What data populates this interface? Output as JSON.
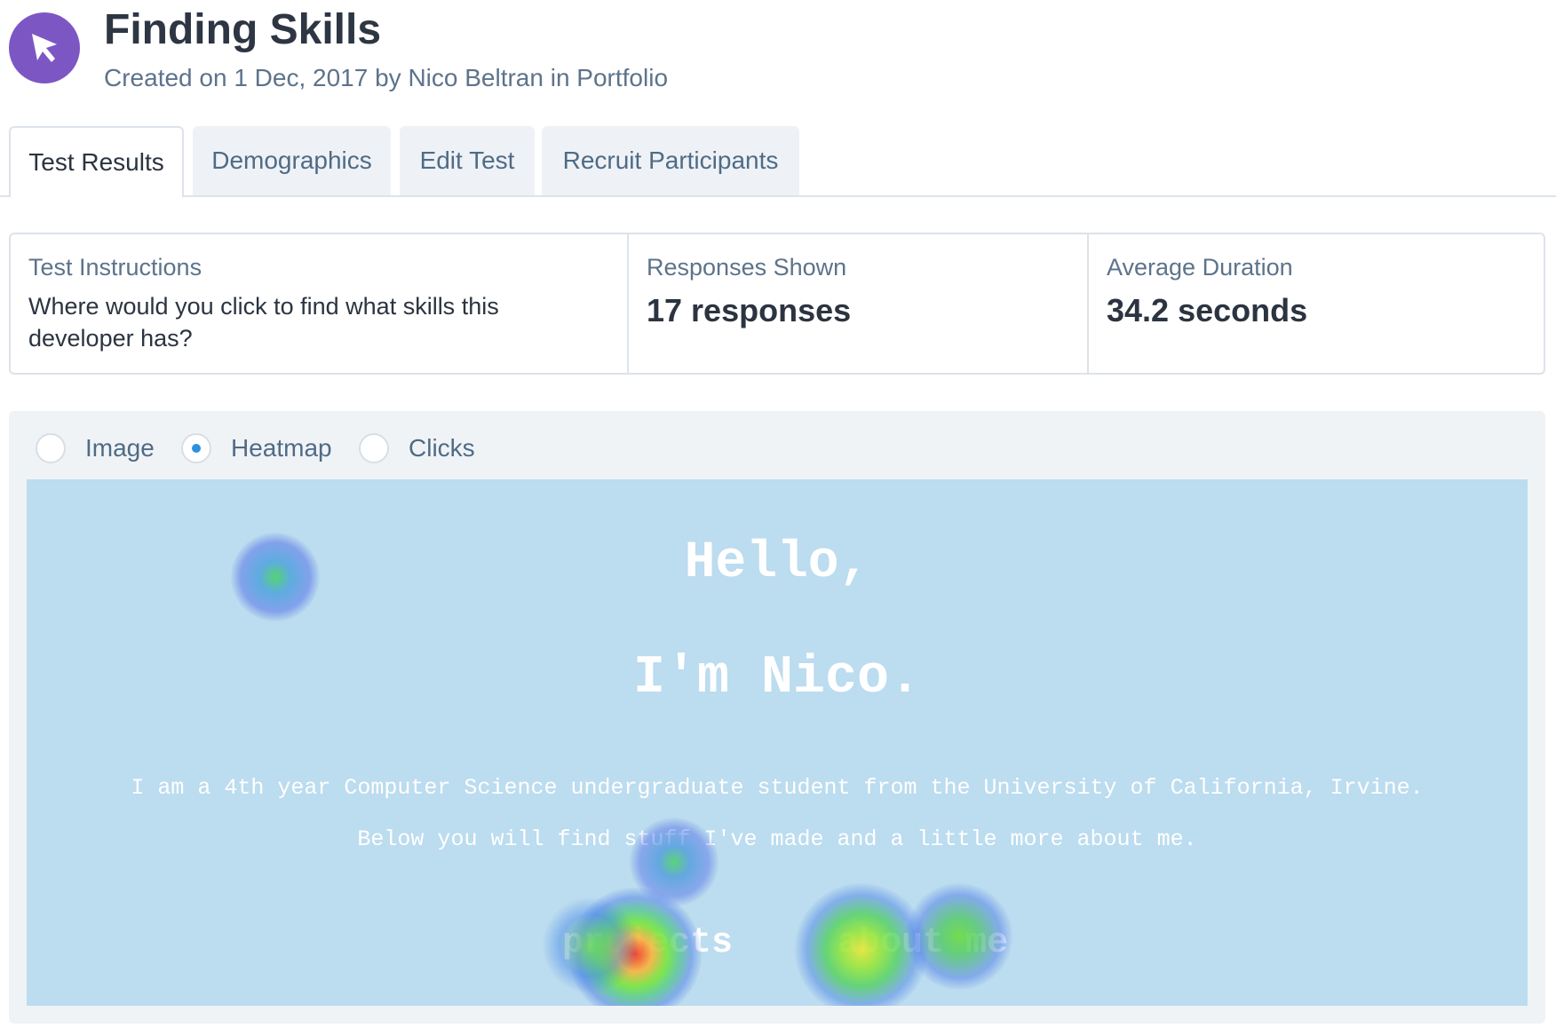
{
  "header": {
    "logo_icon": "cursor-arrow-icon",
    "logo_color": "#7c57c4",
    "title": "Finding Skills",
    "subtitle": "Created on 1 Dec, 2017 by Nico Beltran in Portfolio"
  },
  "tabs": [
    {
      "label": "Test Results",
      "active": true
    },
    {
      "label": "Demographics",
      "active": false
    },
    {
      "label": "Edit Test",
      "active": false
    },
    {
      "label": "Recruit Participants",
      "active": false
    }
  ],
  "stats": {
    "instructions_label": "Test Instructions",
    "instructions_text": "Where would you click to find what skills this developer has?",
    "responses_label": "Responses Shown",
    "responses_value": "17 responses",
    "duration_label": "Average Duration",
    "duration_value": "34.2 seconds"
  },
  "view_options": {
    "selected": "Heatmap",
    "options": [
      "Image",
      "Heatmap",
      "Clicks"
    ],
    "accent": "#2f8fe0"
  },
  "screenshot": {
    "background": "#bcdcef",
    "greeting": "Hello,",
    "name": "I'm Nico.",
    "bio_line1": "I am a 4th year Computer Science undergraduate student from the University of California, Irvine.",
    "bio_line2": "Below you will find stuff I've made and a little more about me.",
    "link_projects": "projects",
    "link_about": "about me"
  }
}
